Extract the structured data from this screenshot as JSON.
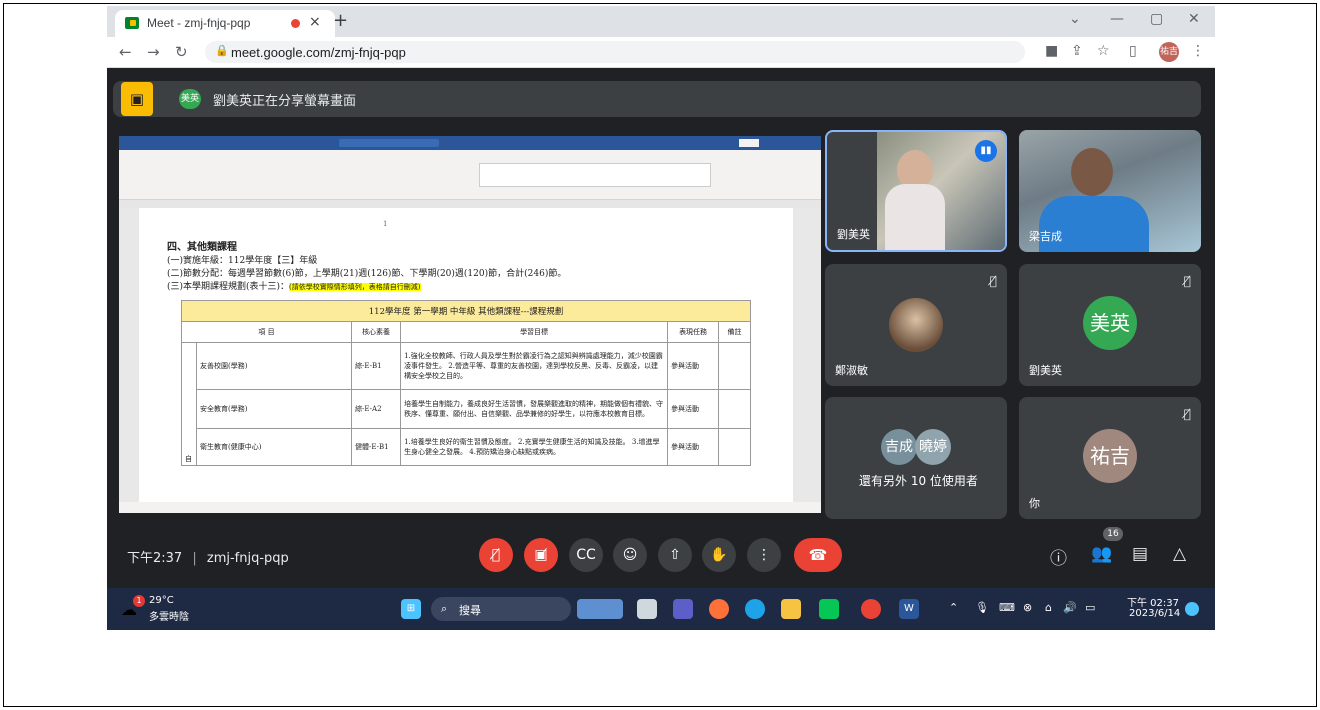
{
  "browser": {
    "tab_title": "Meet - zmj-fnjq-pqp",
    "url": "meet.google.com/zmj-fnjq-pqp",
    "profile_initials": "祐吉",
    "new_tab": "+",
    "close_tab": "×",
    "minimize": "—",
    "maximize": "▢",
    "close": "✕",
    "chevron": "⌄"
  },
  "share_banner": {
    "avatar": "美英",
    "text": "劉美英正在分享螢幕畫面"
  },
  "doc": {
    "page_number": "1",
    "heading": "四、其他類課程",
    "line1": "(一)實施年級：112學年度【三】年級",
    "line2": "(二)節數分配：每週學習節數(6)節，上學期(21)週(126)節、下學期(20)週(120)節，合計(246)節。",
    "line3_prefix": "(三)本學期課程規劃(表十三)：",
    "line3_highlight": "(請依學校實際情形填列，表格請自行刪減)",
    "table_title": "112學年度  第一學期  中年級  其他類課程---課程規劃",
    "headers": [
      "項    目",
      "核心素養",
      "學習目標",
      "表現任務",
      "備註"
    ],
    "rows": [
      {
        "item": "友善校園(學務)",
        "core": "綜-E-B1",
        "goal": "1.強化全校教師、行政人員及學生對於霸凌行為之認知與辨識處理能力，減少校園霸凌事件發生。 2.營造平等、尊重的友善校園，達到學校反黑、反毒、反霸凌，以建構安全學校之目的。",
        "task": "參與活動"
      },
      {
        "item": "安全教育(學務)",
        "core": "綜-E-A2",
        "goal": "培養學生自制能力，養成良好生活習慣，發展樂觀進取的精神，期能做個有禮貌、守秩序、懂尊重、願付出、自信樂觀、品學兼修的好學生，以符應本校教育目標。",
        "task": "參與活動"
      },
      {
        "item": "衛生教育(健康中心)",
        "core": "健體-E-B1",
        "goal": "1.培養學生良好的衛生習慣及態度。 2.充實學生健康生活的知識及技能。 3.增進學生身心健全之發展。 4.預防矯治身心缺點或疾病。",
        "task": "參與活動"
      }
    ],
    "row_group": "自"
  },
  "participants": [
    {
      "name": "劉美英",
      "type": "video"
    },
    {
      "name": "梁吉成",
      "type": "video"
    },
    {
      "name": "鄭淑敏",
      "type": "photo"
    },
    {
      "name": "劉美英",
      "type": "initials",
      "initials": "美英",
      "color": "#34a853"
    },
    {
      "name": "還有另外 10 位使用者",
      "type": "group",
      "initials": [
        "吉成",
        "曉婷"
      ]
    },
    {
      "name": "你",
      "type": "initials",
      "initials": "祐吉",
      "color": "#a1887f"
    }
  ],
  "meeting": {
    "time": "下午2:37",
    "code": "zmj-fnjq-pqp",
    "participant_count": "16"
  },
  "taskbar": {
    "temp": "29°C",
    "weather": "多雲時陰",
    "weather_badge": "1",
    "search": "搜尋",
    "clock_time": "下午 02:37",
    "clock_date": "2023/6/14"
  }
}
